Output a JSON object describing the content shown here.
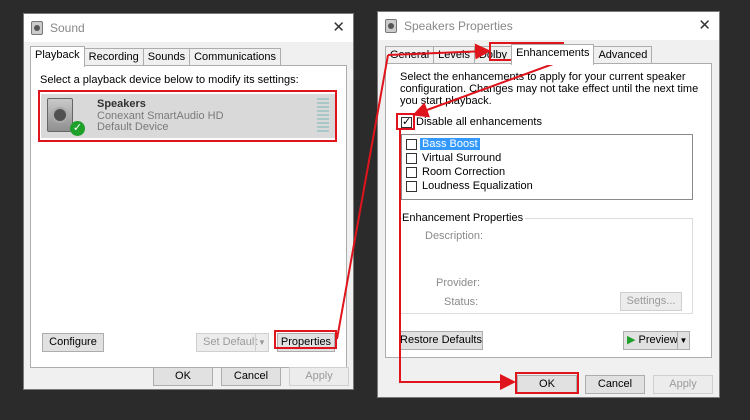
{
  "sound": {
    "title": "Sound",
    "tabs": [
      "Playback",
      "Recording",
      "Sounds",
      "Communications"
    ],
    "instruction": "Select a playback device below to modify its settings:",
    "device": {
      "name": "Speakers",
      "driver": "Conexant SmartAudio HD",
      "status": "Default Device"
    },
    "configure": "Configure",
    "set_default": "Set Default",
    "properties": "Properties",
    "ok": "OK",
    "cancel": "Cancel",
    "apply": "Apply"
  },
  "props": {
    "title": "Speakers Properties",
    "tabs": [
      "General",
      "Levels",
      "Dolby",
      "Enhancements",
      "Advanced"
    ],
    "instruction": "Select the enhancements to apply for your current speaker configuration. Changes may not take effect until the next time you start playback.",
    "disable_all": "Disable all enhancements",
    "enhancements": [
      "Bass Boost",
      "Virtual Surround",
      "Room Correction",
      "Loudness Equalization"
    ],
    "group_title": "Enhancement Properties",
    "description_label": "Description:",
    "provider_label": "Provider:",
    "status_label": "Status:",
    "settings": "Settings...",
    "restore": "Restore Defaults",
    "preview": "Preview",
    "ok": "OK",
    "cancel": "Cancel",
    "apply": "Apply"
  },
  "colors": {
    "highlight": "#e0141c",
    "selection": "#3399ff",
    "check": "#1fa02a"
  }
}
